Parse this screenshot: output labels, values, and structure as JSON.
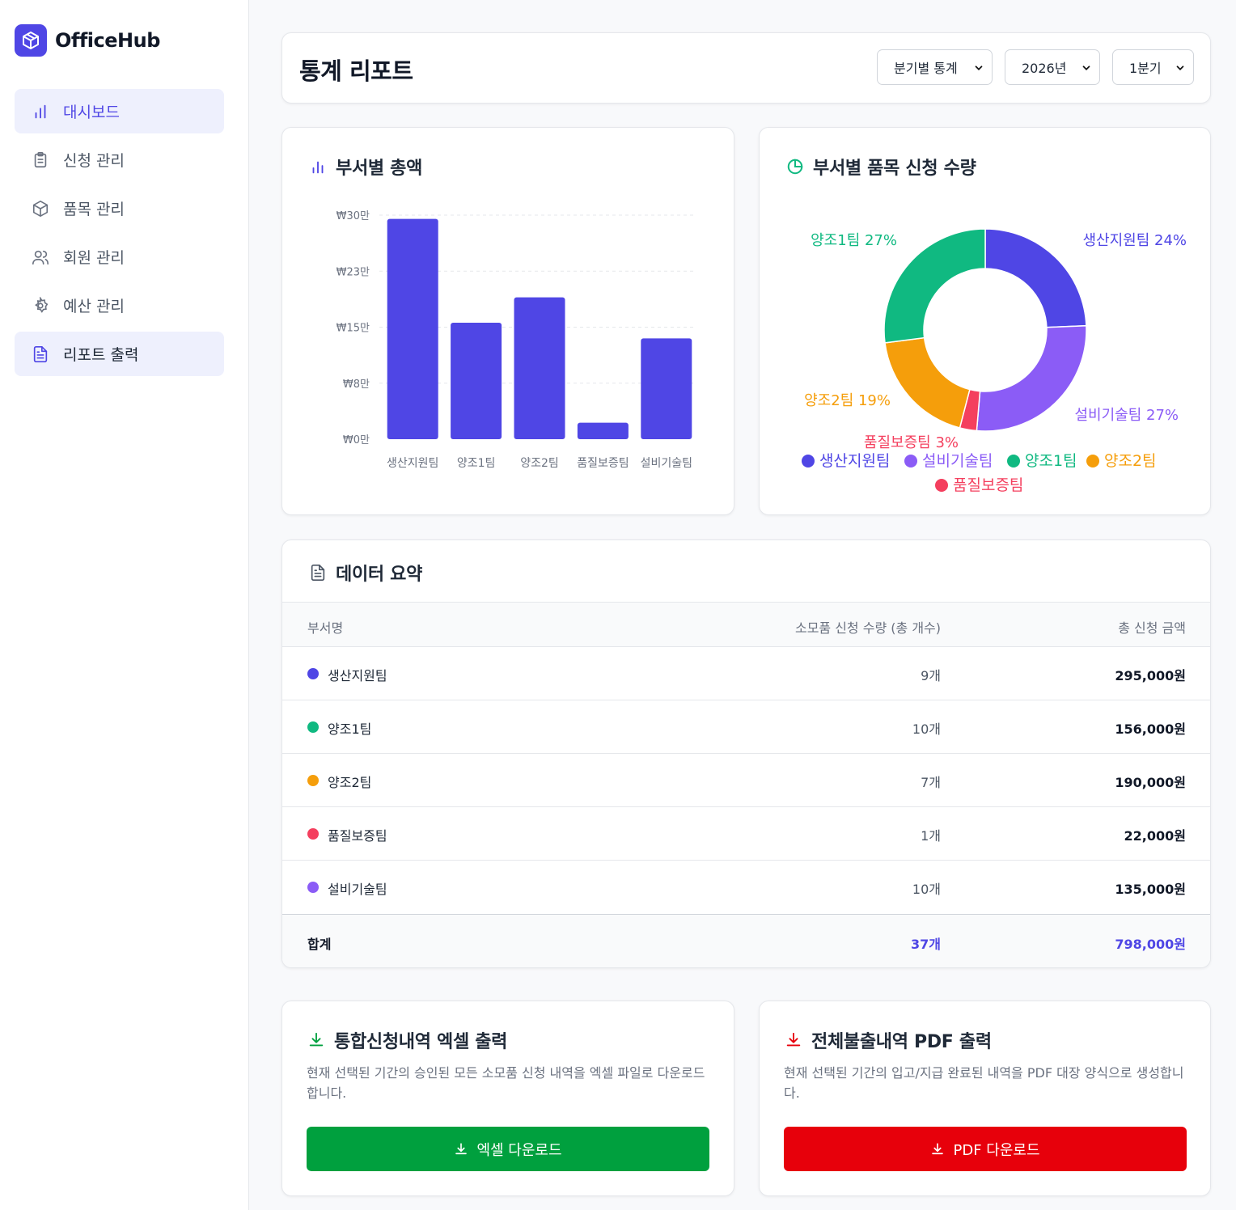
{
  "app": {
    "name": "OfficeHub"
  },
  "sidebar": {
    "items": [
      {
        "label": "대시보드",
        "icon": "bar-chart-icon",
        "active": true
      },
      {
        "label": "신청 관리",
        "icon": "clipboard-icon",
        "active": false
      },
      {
        "label": "품목 관리",
        "icon": "box-icon",
        "active": false
      },
      {
        "label": "회원 관리",
        "icon": "users-icon",
        "active": false
      },
      {
        "label": "예산 관리",
        "icon": "gear-icon",
        "active": false
      },
      {
        "label": "리포트 출력",
        "icon": "file-text-icon",
        "active": true
      }
    ]
  },
  "header": {
    "title": "통계 리포트",
    "filters": {
      "type": "분기별 통계",
      "year": "2026년",
      "quarter": "1분기"
    }
  },
  "bar_card": {
    "title": "부서별 총액"
  },
  "pie_card": {
    "title": "부서별 품목 신청 수량"
  },
  "chart_data": [
    {
      "type": "bar",
      "title": "부서별 총액",
      "categories": [
        "생산지원팀",
        "양조1팀",
        "양조2팀",
        "품질보증팀",
        "설비기술팀"
      ],
      "values": [
        295000,
        156000,
        190000,
        22000,
        135000
      ],
      "y_ticks": [
        "₩0만",
        "₩8만",
        "₩15만",
        "₩23만",
        "₩30만"
      ],
      "ylim": [
        0,
        300000
      ],
      "color": "#4f46e5",
      "grid": true
    },
    {
      "type": "pie",
      "title": "부서별 품목 신청 수량",
      "slices": [
        {
          "name": "생산지원팀",
          "value": 9,
          "label": "생산지원팀 24%",
          "color": "#4f46e5"
        },
        {
          "name": "설비기술팀",
          "value": 10,
          "label": "설비기술팀 27%",
          "color": "#8b5cf6"
        },
        {
          "name": "품질보증팀",
          "value": 1,
          "label": "품질보증팀 3%",
          "color": "#f43f5e"
        },
        {
          "name": "양조2팀",
          "value": 7,
          "label": "양조2팀 19%",
          "color": "#f59e0b"
        },
        {
          "name": "양조1팀",
          "value": 10,
          "label": "양조1팀 27%",
          "color": "#10b981"
        }
      ],
      "legend": [
        "생산지원팀",
        "설비기술팀",
        "양조1팀",
        "양조2팀",
        "품질보증팀"
      ]
    }
  ],
  "summary": {
    "title": "데이터 요약",
    "columns": [
      "부서명",
      "소모품 신청 수량 (총 개수)",
      "총 신청 금액"
    ],
    "rows": [
      {
        "name": "생산지원팀",
        "qty": "9개",
        "amount": "295,000원",
        "color": "#4f46e5"
      },
      {
        "name": "양조1팀",
        "qty": "10개",
        "amount": "156,000원",
        "color": "#10b981"
      },
      {
        "name": "양조2팀",
        "qty": "7개",
        "amount": "190,000원",
        "color": "#f59e0b"
      },
      {
        "name": "품질보증팀",
        "qty": "1개",
        "amount": "22,000원",
        "color": "#f43f5e"
      },
      {
        "name": "설비기술팀",
        "qty": "10개",
        "amount": "135,000원",
        "color": "#8b5cf6"
      }
    ],
    "total": {
      "label": "합계",
      "qty": "37개",
      "amount": "798,000원"
    }
  },
  "exports": {
    "excel": {
      "title": "통합신청내역 엑셀 출력",
      "desc": "현재 선택된 기간의 승인된 모든 소모품 신청 내역을 엑셀 파일로 다운로드합니다.",
      "button": "엑셀 다운로드",
      "color": "#00a03e"
    },
    "pdf": {
      "title": "전체불출내역 PDF 출력",
      "desc": "현재 선택된 기간의 입고/지급 완료된 내역을 PDF 대장 양식으로 생성합니다.",
      "button": "PDF 다운로드",
      "color": "#e7000b"
    }
  }
}
